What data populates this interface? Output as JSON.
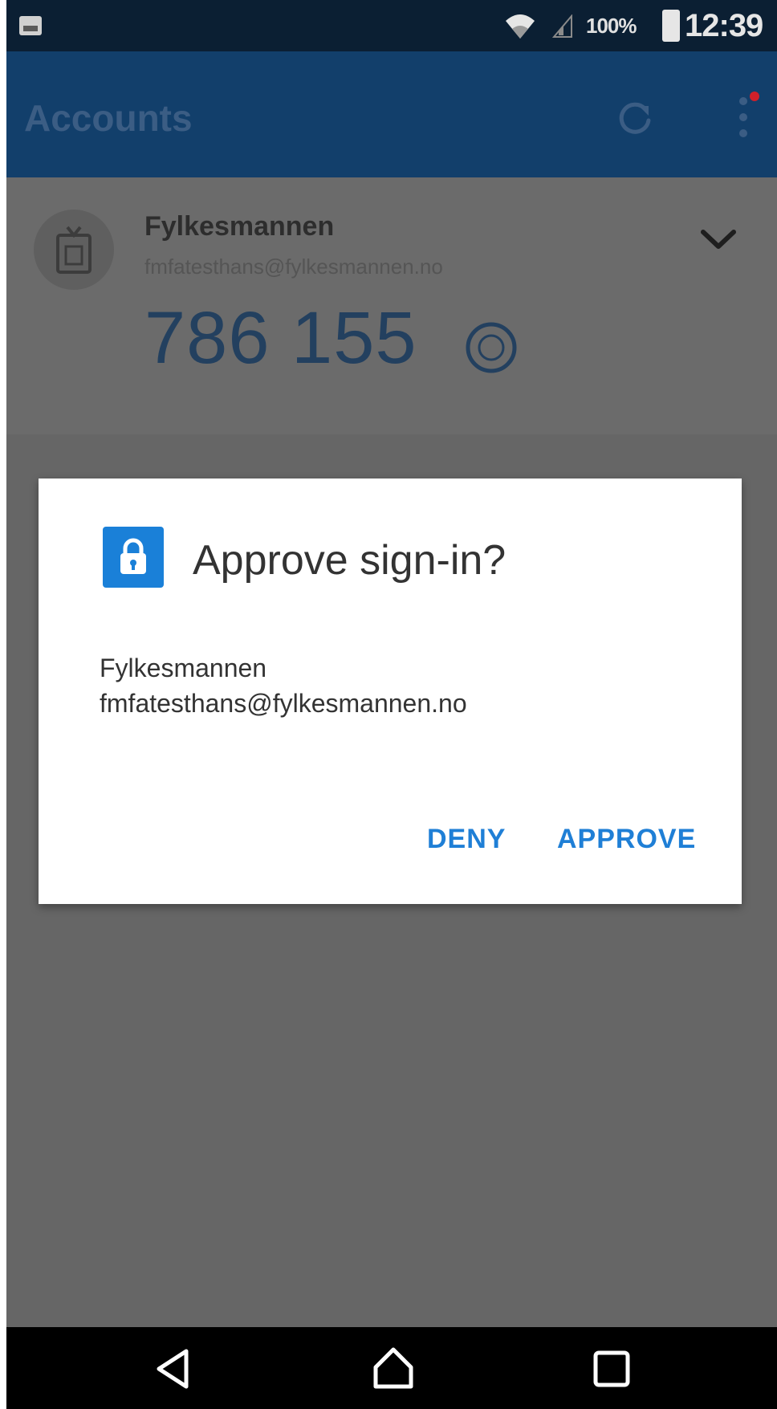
{
  "status_bar": {
    "battery_percent": "100%",
    "time": "12:39",
    "icons": [
      "image-notification-icon",
      "wifi-icon",
      "signal-icon",
      "battery-icon"
    ]
  },
  "app_bar": {
    "title": "Accounts",
    "icons": [
      "refresh-icon",
      "overflow-menu-icon"
    ]
  },
  "account": {
    "name": "Fylkesmannen",
    "email": "fmfatesthans@fylkesmannen.no",
    "code": "786 155",
    "icons": [
      "badge-icon",
      "timer-icon",
      "chevron-down-icon"
    ]
  },
  "dialog": {
    "title": "Approve sign-in?",
    "account_name": "Fylkesmannen",
    "account_email": "fmfatesthans@fylkesmannen.no",
    "deny_label": "DENY",
    "approve_label": "APPROVE",
    "icon": "lock-icon"
  },
  "nav_bar": {
    "icons": [
      "back-icon",
      "home-icon",
      "recents-icon"
    ]
  },
  "colors": {
    "app_bar": "#123f6b",
    "accent": "#1f7fd6",
    "scrim": "#666666"
  }
}
